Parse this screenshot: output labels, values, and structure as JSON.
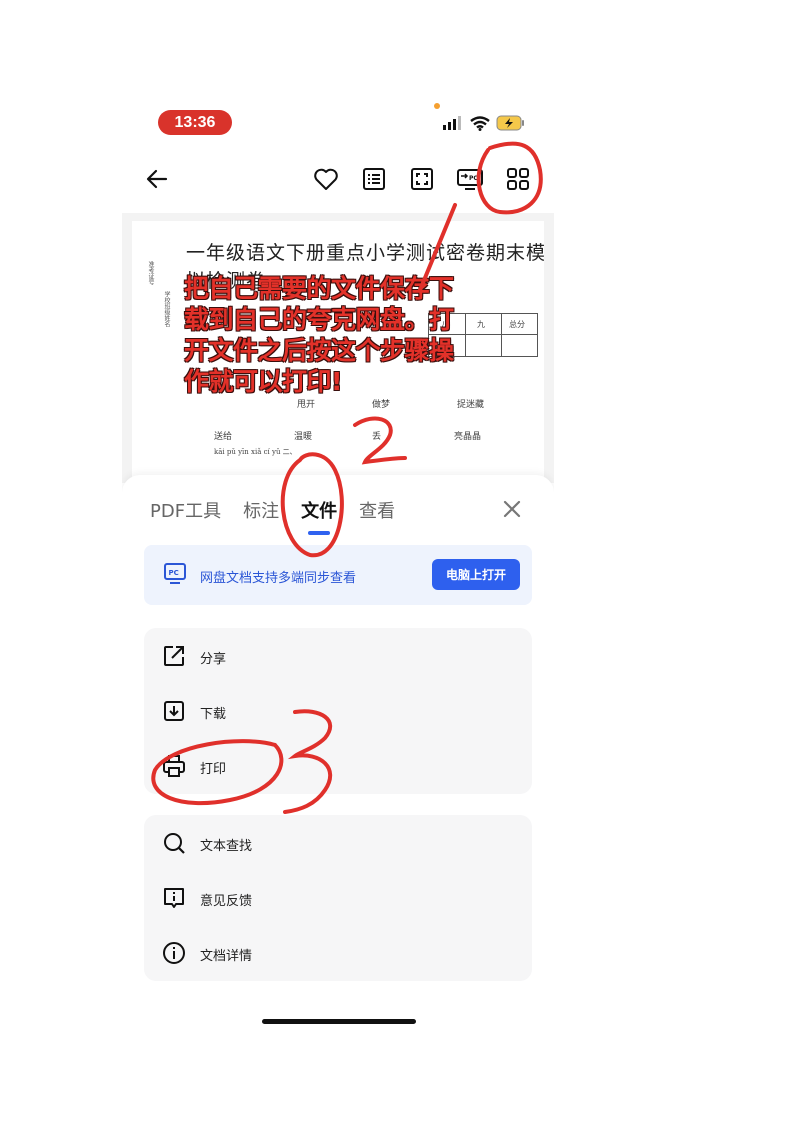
{
  "status_bar": {
    "time": "13:36"
  },
  "toolbar": {
    "icons": [
      "back-arrow-icon",
      "heart-icon",
      "list-icon",
      "fullscreen-icon",
      "pc-screen-icon",
      "grid-icon"
    ]
  },
  "document": {
    "title": "一年级语文下册重点小学测试密卷期末模拟检测卷",
    "table_headers": [
      "八",
      "九",
      "总分"
    ],
    "words_row1": [
      "甩开",
      "做梦",
      "捉迷藏"
    ],
    "words_row2": [
      "送给",
      "温暖",
      "丢",
      "亮晶晶"
    ],
    "pinyin_row": "kāi pǔ yīn  xiǎ  cí  yǔ  二、"
  },
  "annotation": {
    "text": "把自己需要的文件保存下载到自己的夸克网盘。打开文件之后按这个步骤操作就可以打印!",
    "color": "#e33129"
  },
  "sheet": {
    "tabs": [
      {
        "label": "PDF工具"
      },
      {
        "label": "标注"
      },
      {
        "label": "文件"
      },
      {
        "label": "查看"
      }
    ],
    "active_tab": "文件",
    "accent": "#2f62f0",
    "banner": {
      "text": "网盘文档支持多端同步查看",
      "button": "电脑上打开"
    },
    "group1": [
      {
        "label": "分享",
        "icon": "share-icon"
      },
      {
        "label": "下载",
        "icon": "download-icon"
      },
      {
        "label": "打印",
        "icon": "printer-icon"
      }
    ],
    "group2": [
      {
        "label": "文本查找",
        "icon": "search-icon"
      },
      {
        "label": "意见反馈",
        "icon": "feedback-icon"
      },
      {
        "label": "文档详情",
        "icon": "info-icon"
      }
    ]
  }
}
